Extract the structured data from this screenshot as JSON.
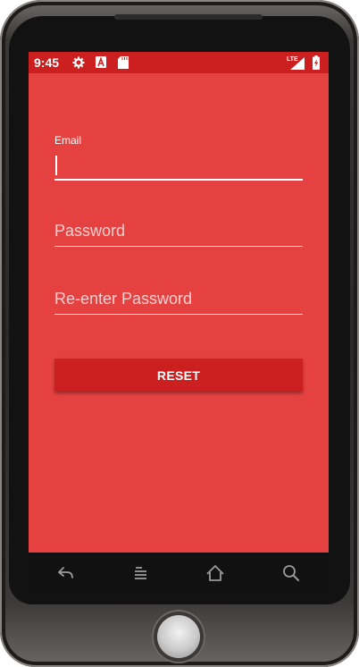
{
  "status_bar": {
    "time": "9:45",
    "icons_left": [
      "gear-icon",
      "a-notification-icon",
      "sd-card-icon"
    ],
    "network_label": "LTE",
    "icons_right": [
      "signal-icon",
      "battery-charging-icon"
    ]
  },
  "form": {
    "email_label": "Email",
    "email_value": "",
    "password_placeholder": "Password",
    "reenter_placeholder": "Re-enter Password",
    "reset_label": "RESET"
  },
  "nav_bar": {
    "icons": [
      "back-icon",
      "menu-icon",
      "home-icon",
      "search-icon"
    ]
  },
  "colors": {
    "screen_background": "#e54141",
    "status_bar": "#cc1f1f",
    "button": "#cc1f1f",
    "text": "#ffffff"
  }
}
